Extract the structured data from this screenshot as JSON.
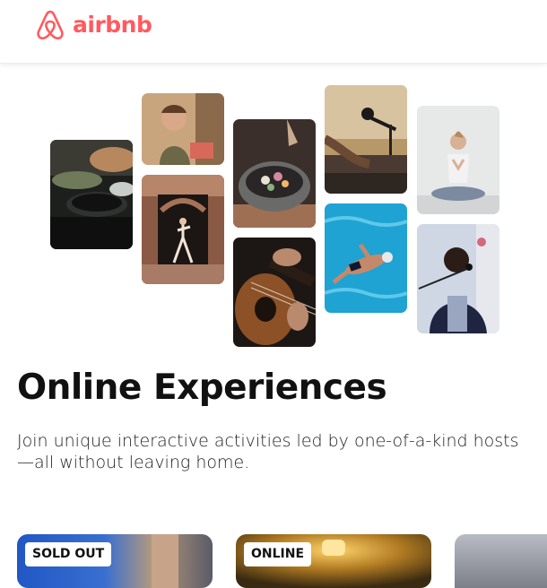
{
  "header": {
    "logo_text": "airbnb",
    "brand_color": "#FF5A5F"
  },
  "hero": {
    "title": "Online Experiences",
    "subtitle": "Join unique interactive activities led by one-of-a-kind hosts—all without leaving home."
  },
  "collage": [
    {
      "subject": "cooking-pans"
    },
    {
      "subject": "host-with-book"
    },
    {
      "subject": "dancer-in-doorway"
    },
    {
      "subject": "plated-dish"
    },
    {
      "subject": "acoustic-guitar"
    },
    {
      "subject": "keyboard-and-microphone"
    },
    {
      "subject": "swimmer-in-pool"
    },
    {
      "subject": "yoga-meditation"
    },
    {
      "subject": "singer-with-microphone"
    }
  ],
  "cards": [
    {
      "badge": "SOLD OUT"
    },
    {
      "badge": "ONLINE"
    },
    {
      "badge": ""
    }
  ]
}
